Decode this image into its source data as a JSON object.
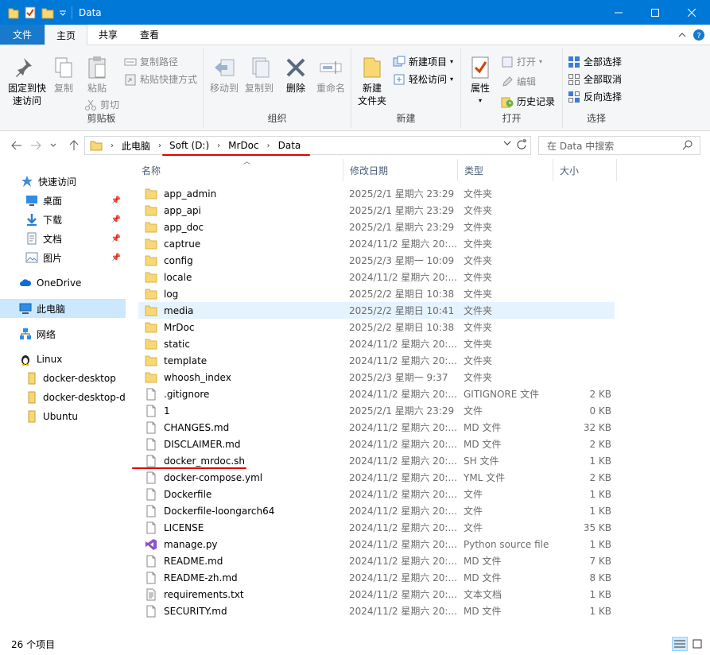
{
  "window": {
    "title": "Data"
  },
  "tabs": [
    "文件",
    "主页",
    "共享",
    "查看"
  ],
  "ribbon": {
    "clipboard": {
      "label": "剪贴板",
      "pin": "固定到快\n速访问",
      "copy": "复制",
      "paste": "粘贴",
      "copy_path": "复制路径",
      "paste_shortcut": "粘贴快捷方式",
      "cut": "剪切"
    },
    "organize": {
      "label": "组织",
      "move_to": "移动到",
      "copy_to": "复制到",
      "delete": "删除",
      "rename": "重命名"
    },
    "new": {
      "label": "新建",
      "new_folder": "新建\n文件夹",
      "new_item": "新建项目",
      "easy_access": "轻松访问"
    },
    "open": {
      "label": "打开",
      "properties": "属性",
      "open": "打开",
      "edit": "编辑",
      "history": "历史记录"
    },
    "select": {
      "label": "选择",
      "select_all": "全部选择",
      "select_none": "全部取消",
      "invert": "反向选择"
    }
  },
  "address": {
    "crumbs": [
      "此电脑",
      "Soft (D:)",
      "MrDoc",
      "Data"
    ],
    "search_placeholder": "在 Data 中搜索"
  },
  "nav": {
    "quick_access": "快速访问",
    "desktop": "桌面",
    "downloads": "下载",
    "documents": "文档",
    "pictures": "图片",
    "onedrive": "OneDrive",
    "this_pc": "此电脑",
    "network": "网络",
    "linux": "Linux",
    "docker_desktop": "docker-desktop",
    "docker_desktop_data": "docker-desktop-d",
    "ubuntu": "Ubuntu"
  },
  "columns": {
    "name": "名称",
    "date": "修改日期",
    "type": "类型",
    "size": "大小"
  },
  "files": [
    {
      "name": "app_admin",
      "date": "2025/2/1 星期六 23:29",
      "type": "文件夹",
      "size": "",
      "icon": "folder"
    },
    {
      "name": "app_api",
      "date": "2025/2/1 星期六 23:29",
      "type": "文件夹",
      "size": "",
      "icon": "folder"
    },
    {
      "name": "app_doc",
      "date": "2025/2/1 星期六 23:29",
      "type": "文件夹",
      "size": "",
      "icon": "folder"
    },
    {
      "name": "captrue",
      "date": "2024/11/2 星期六 20:...",
      "type": "文件夹",
      "size": "",
      "icon": "folder"
    },
    {
      "name": "config",
      "date": "2025/2/3 星期一 10:09",
      "type": "文件夹",
      "size": "",
      "icon": "folder"
    },
    {
      "name": "locale",
      "date": "2024/11/2 星期六 20:...",
      "type": "文件夹",
      "size": "",
      "icon": "folder"
    },
    {
      "name": "log",
      "date": "2025/2/2 星期日 10:38",
      "type": "文件夹",
      "size": "",
      "icon": "folder"
    },
    {
      "name": "media",
      "date": "2025/2/2 星期日 10:41",
      "type": "文件夹",
      "size": "",
      "icon": "folder"
    },
    {
      "name": "MrDoc",
      "date": "2025/2/2 星期日 10:38",
      "type": "文件夹",
      "size": "",
      "icon": "folder"
    },
    {
      "name": "static",
      "date": "2024/11/2 星期六 20:...",
      "type": "文件夹",
      "size": "",
      "icon": "folder"
    },
    {
      "name": "template",
      "date": "2024/11/2 星期六 20:...",
      "type": "文件夹",
      "size": "",
      "icon": "folder"
    },
    {
      "name": "whoosh_index",
      "date": "2025/2/3 星期一 9:37",
      "type": "文件夹",
      "size": "",
      "icon": "folder"
    },
    {
      "name": ".gitignore",
      "date": "2024/11/2 星期六 20:...",
      "type": "GITIGNORE 文件",
      "size": "2 KB",
      "icon": "file"
    },
    {
      "name": "1",
      "date": "2025/2/1 星期六 23:29",
      "type": "文件",
      "size": "0 KB",
      "icon": "file"
    },
    {
      "name": "CHANGES.md",
      "date": "2024/11/2 星期六 20:...",
      "type": "MD 文件",
      "size": "32 KB",
      "icon": "file"
    },
    {
      "name": "DISCLAIMER.md",
      "date": "2024/11/2 星期六 20:...",
      "type": "MD 文件",
      "size": "2 KB",
      "icon": "file"
    },
    {
      "name": "docker_mrdoc.sh",
      "date": "2024/11/2 星期六 20:...",
      "type": "SH 文件",
      "size": "1 KB",
      "icon": "file"
    },
    {
      "name": "docker-compose.yml",
      "date": "2024/11/2 星期六 20:...",
      "type": "YML 文件",
      "size": "2 KB",
      "icon": "file"
    },
    {
      "name": "Dockerfile",
      "date": "2024/11/2 星期六 20:...",
      "type": "文件",
      "size": "1 KB",
      "icon": "file"
    },
    {
      "name": "Dockerfile-loongarch64",
      "date": "2024/11/2 星期六 20:...",
      "type": "文件",
      "size": "1 KB",
      "icon": "file"
    },
    {
      "name": "LICENSE",
      "date": "2024/11/2 星期六 20:...",
      "type": "文件",
      "size": "35 KB",
      "icon": "file"
    },
    {
      "name": "manage.py",
      "date": "2024/11/2 星期六 20:...",
      "type": "Python source file",
      "size": "1 KB",
      "icon": "python"
    },
    {
      "name": "README.md",
      "date": "2024/11/2 星期六 20:...",
      "type": "MD 文件",
      "size": "7 KB",
      "icon": "file"
    },
    {
      "name": "README-zh.md",
      "date": "2024/11/2 星期六 20:...",
      "type": "MD 文件",
      "size": "8 KB",
      "icon": "file"
    },
    {
      "name": "requirements.txt",
      "date": "2024/11/2 星期六 20:...",
      "type": "文本文档",
      "size": "1 KB",
      "icon": "text"
    },
    {
      "name": "SECURITY.md",
      "date": "2024/11/2 星期六 20:...",
      "type": "MD 文件",
      "size": "1 KB",
      "icon": "file"
    }
  ],
  "status": {
    "count": "26 个项目"
  },
  "colors": {
    "accent": "#0078d7",
    "folder": "#f8d775",
    "selected": "#cce8ff",
    "hover": "#e5f3ff",
    "annotation": "#e00000"
  }
}
